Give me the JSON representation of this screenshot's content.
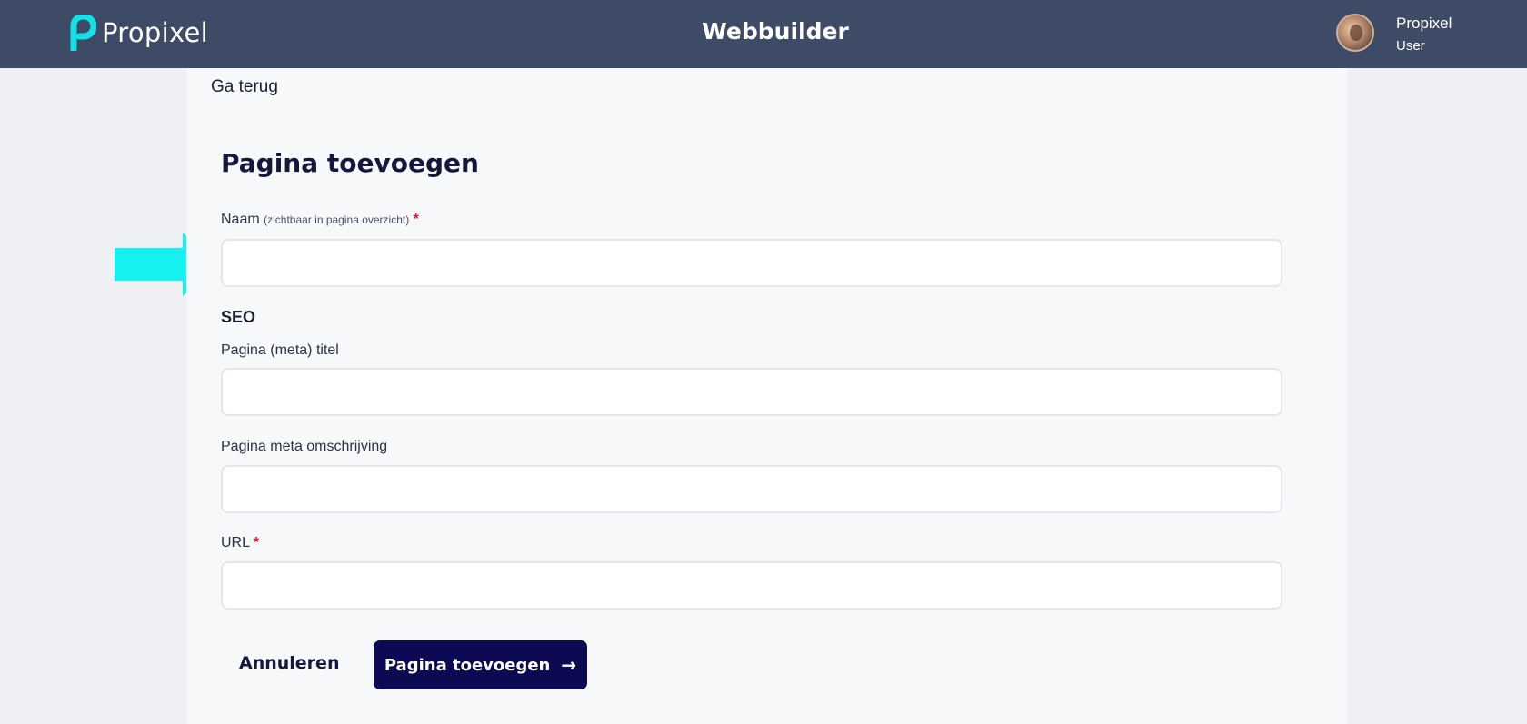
{
  "header": {
    "brand": "Propixel",
    "title": "Webbuilder",
    "user": {
      "name": "Propixel",
      "role": "User"
    }
  },
  "nav": {
    "back_label": "Ga terug"
  },
  "form": {
    "title": "Pagina toevoegen",
    "name_label": "Naam",
    "name_hint": "(zichtbaar in pagina overzicht)",
    "required_mark": "*",
    "name_value": "",
    "seo_heading": "SEO",
    "meta_title_label": "Pagina (meta) titel",
    "meta_title_value": "",
    "meta_description_label": "Pagina meta omschrijving",
    "meta_description_value": "",
    "url_label": "URL",
    "url_value": ""
  },
  "actions": {
    "cancel_label": "Annuleren",
    "submit_label": "Pagina toevoegen"
  },
  "colors": {
    "topbar": "#3d4b66",
    "accent": "#15e0e8",
    "primary_button": "#0b0a52",
    "required": "#e0182d"
  }
}
